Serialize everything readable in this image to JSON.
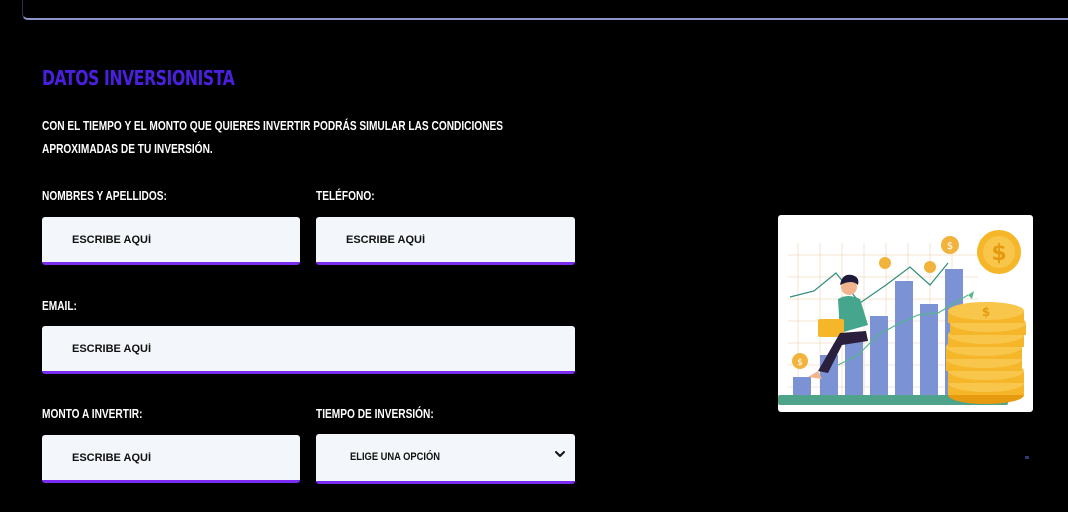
{
  "form": {
    "title": "DATOS INVERSIONISTA",
    "intro": "CON EL TIEMPO Y EL MONTO QUE QUIERES INVERTIR PODRÁS SIMULAR LAS CONDICIONES APROXIMADAS DE TU INVERSIÓN.",
    "fields": {
      "name": {
        "label": "NOMBRES Y APELLIDOS:",
        "placeholder": "ESCRIBE AQUÍ"
      },
      "phone": {
        "label": "TELÉFONO:",
        "placeholder": "ESCRIBE AQUÍ"
      },
      "email": {
        "label": "EMAIL:",
        "placeholder": "ESCRIBE AQUÍ"
      },
      "amount": {
        "label": "MONTO A INVERTIR:",
        "placeholder": "ESCRIBE AQUÍ"
      },
      "term": {
        "label": "TIEMPO DE INVERSIÓN:",
        "selected": "ELIGE UNA OPCIÓN"
      }
    }
  },
  "illustration": {
    "icon": "investment-growth-illustration",
    "coin_symbol": "$"
  },
  "colors": {
    "background": "#000000",
    "title": "#4b1fe0",
    "input_bg": "#f3f6fa",
    "input_border": "#7a2cf0",
    "top_rule": "#8b95c9"
  }
}
